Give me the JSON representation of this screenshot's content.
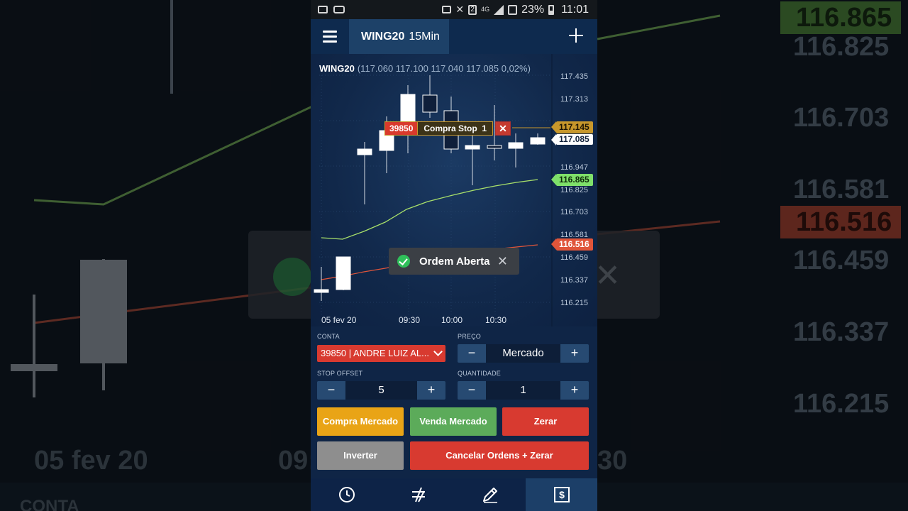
{
  "background_mirror": {
    "price_labels": [
      "116.825",
      "116.703",
      "116.581",
      "116.459",
      "116.337",
      "116.215"
    ],
    "green_tag": "116.865",
    "red_tag": "116.516",
    "x_label": "05 fev 20",
    "x_fragment_left": "09:",
    "x_fragment_right": "30",
    "bottom_label": "CONTA"
  },
  "status_bar": {
    "network": "4G",
    "sim": "2",
    "battery": "23%",
    "time": "11:01"
  },
  "app_bar": {
    "symbol": "WING20",
    "timeframe": "15Min"
  },
  "chart": {
    "quote_symbol": "WING20",
    "quote_values": "(117.060 117.100 117.040 117.085 0,02%)",
    "y_ticks": [
      "117.435",
      "117.313",
      "117.085",
      "116.947",
      "116.825",
      "116.703",
      "116.581",
      "116.459",
      "116.337",
      "116.215"
    ],
    "x_ticks": [
      "05 fev 20",
      "09:30",
      "10:00",
      "10:30"
    ],
    "flags": {
      "stop_price": "117.145",
      "last_price": "117.085",
      "green_ma": "116.865",
      "red_ma": "116.516"
    },
    "order_tag": {
      "account": "39850",
      "description": "Compra Stop",
      "qty": "1"
    },
    "colors": {
      "green_ma": "#a8e06a",
      "red_ma": "#e0553a",
      "stop": "#c7972b"
    }
  },
  "toast": {
    "message": "Ordem Aberta"
  },
  "form": {
    "conta_label": "CONTA",
    "conta_value": "39850 | ANDRE LUIZ AL...",
    "preco_label": "PREÇO",
    "preco_value": "Mercado",
    "stop_offset_label": "STOP OFFSET",
    "stop_offset_value": "5",
    "quantidade_label": "QUANTIDADE",
    "quantidade_value": "1",
    "minus": "−",
    "plus": "+"
  },
  "buttons": {
    "compra_mercado": "Compra Mercado",
    "venda_mercado": "Venda Mercado",
    "zerar": "Zerar",
    "inverter": "Inverter",
    "cancelar": "Cancelar Ordens + Zerar",
    "colors": {
      "compra": "#e9a416",
      "venda": "#5cab5a",
      "zerar": "#d83a30",
      "inverter": "#8e8e8e"
    }
  },
  "nav": [
    {
      "icon": "clock-icon"
    },
    {
      "icon": "chart-tool-icon"
    },
    {
      "icon": "pencil-icon"
    },
    {
      "icon": "dollar-icon"
    }
  ]
}
